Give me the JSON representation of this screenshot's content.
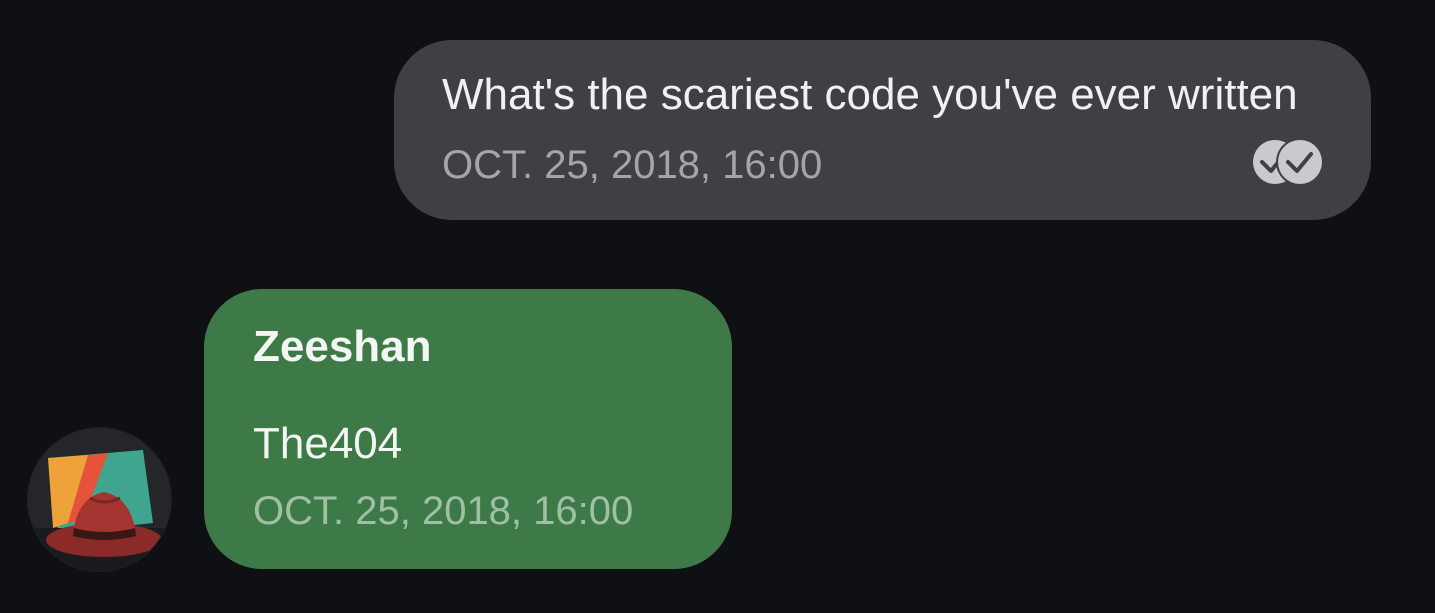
{
  "messages": {
    "outgoing": {
      "text": "What's the scariest code you've ever written",
      "time": "OCT. 25, 2018, 16:00",
      "status_icon": "double-check-read-icon"
    },
    "incoming": {
      "sender": "Zeeshan",
      "text": "The404",
      "time": "OCT. 25, 2018, 16:00",
      "avatar_icon": "red-fedora-avatar"
    }
  },
  "colors": {
    "background": "#0f1013",
    "outgoing_bubble": "#3f3f45",
    "incoming_bubble": "#3e7a48"
  }
}
